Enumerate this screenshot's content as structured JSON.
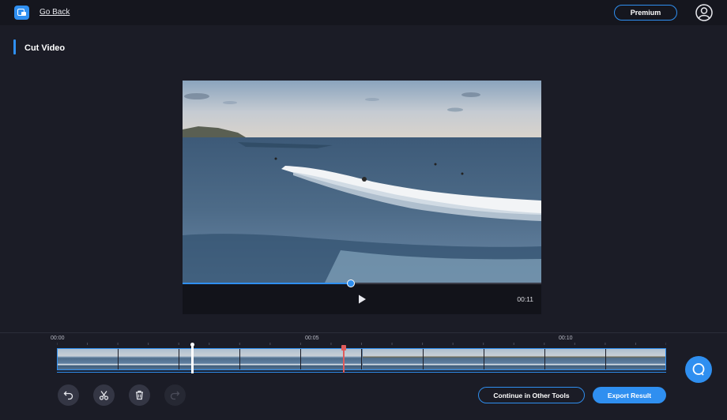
{
  "header": {
    "go_back_label": "Go Back",
    "premium_label": "Premium",
    "logo_icon": "video-tool-logo-icon",
    "user_icon": "user-circle-icon"
  },
  "page": {
    "title": "Cut Video"
  },
  "player": {
    "duration": "00:11",
    "progress_fraction": 0.47,
    "play_icon": "play-icon"
  },
  "timeline": {
    "ticks": [
      "00:00",
      "00:05",
      "00:10"
    ],
    "thumbnail_count": 10,
    "trim_start_fraction": 0.22,
    "playhead_fraction": 0.47
  },
  "toolbar": {
    "undo_icon": "undo-icon",
    "cut_icon": "scissors-icon",
    "delete_icon": "trash-icon",
    "redo_icon": "redo-icon"
  },
  "actions": {
    "continue_label": "Continue in Other Tools",
    "export_label": "Export Result"
  },
  "colors": {
    "accent": "#2f8ff0",
    "background": "#1b1c26",
    "playhead": "#e05b5b"
  }
}
